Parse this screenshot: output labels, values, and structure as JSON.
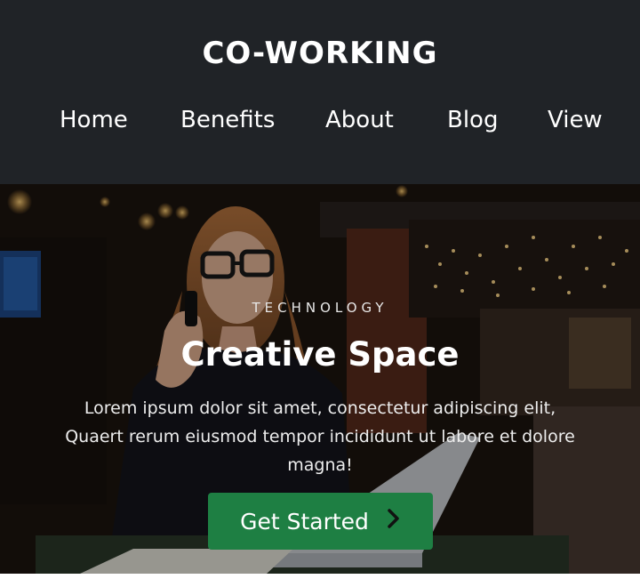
{
  "header": {
    "logo": "CO-WORKING",
    "nav": [
      {
        "label": "Home"
      },
      {
        "label": "Benefits"
      },
      {
        "label": "About"
      },
      {
        "label": "Blog"
      },
      {
        "label": "View"
      }
    ]
  },
  "hero": {
    "eyebrow": "TECHNOLOGY",
    "headline": "Creative Space",
    "description": "Lorem ipsum dolor sit amet, consectetur adipiscing elit, Quaert rerum eiusmod tempor incididunt ut labore et dolore magna!",
    "cta_label": "Get Started",
    "cta_icon": "chevron-right-icon"
  },
  "colors": {
    "header_bg": "#202327",
    "cta_bg": "#1e7f43",
    "text": "#ffffff"
  }
}
